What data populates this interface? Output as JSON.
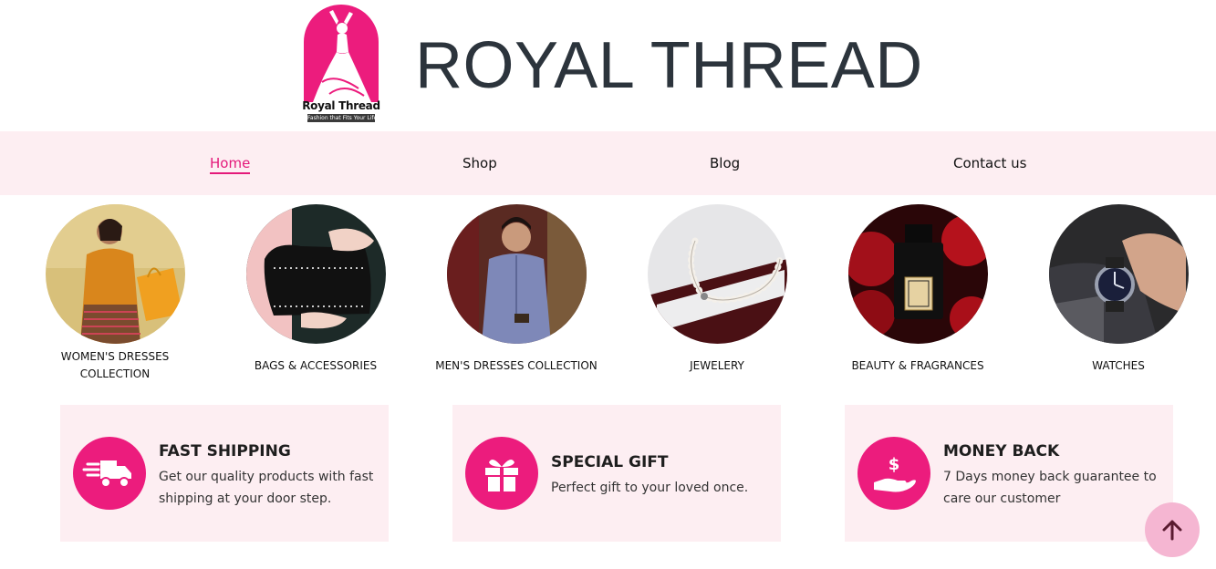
{
  "brand": {
    "logo_name": "Royal Thread",
    "logo_tagline": "Fashion that Fits Your Life",
    "title": "ROYAL THREAD",
    "accent_color": "#ec1c7d"
  },
  "nav": {
    "items": [
      {
        "label": "Home",
        "active": true
      },
      {
        "label": "Shop",
        "active": false
      },
      {
        "label": "Blog",
        "active": false
      },
      {
        "label": "Contact us",
        "active": false
      }
    ]
  },
  "categories": [
    {
      "label_line1": "WOMEN'S DRESSES",
      "label_line2": "COLLECTION"
    },
    {
      "label_line1": "BAGS & ACCESSORIES",
      "label_line2": ""
    },
    {
      "label_line1": "MEN'S DRESSES COLLECTION",
      "label_line2": ""
    },
    {
      "label_line1": "JEWELERY",
      "label_line2": ""
    },
    {
      "label_line1": "BEAUTY & FRAGRANCES",
      "label_line2": ""
    },
    {
      "label_line1": "WATCHES",
      "label_line2": ""
    }
  ],
  "features": [
    {
      "title": "FAST SHIPPING",
      "desc": "Get our quality products with fast shipping at your door step.",
      "icon": "truck-icon"
    },
    {
      "title": "SPECIAL GIFT",
      "desc": "Perfect gift to your loved once.",
      "icon": "gift-icon"
    },
    {
      "title": "MONEY BACK",
      "desc": "7 Days money back guarantee to care our customer",
      "icon": "money-hand-icon"
    }
  ],
  "scroll_top": {
    "icon": "arrow-up-icon"
  }
}
